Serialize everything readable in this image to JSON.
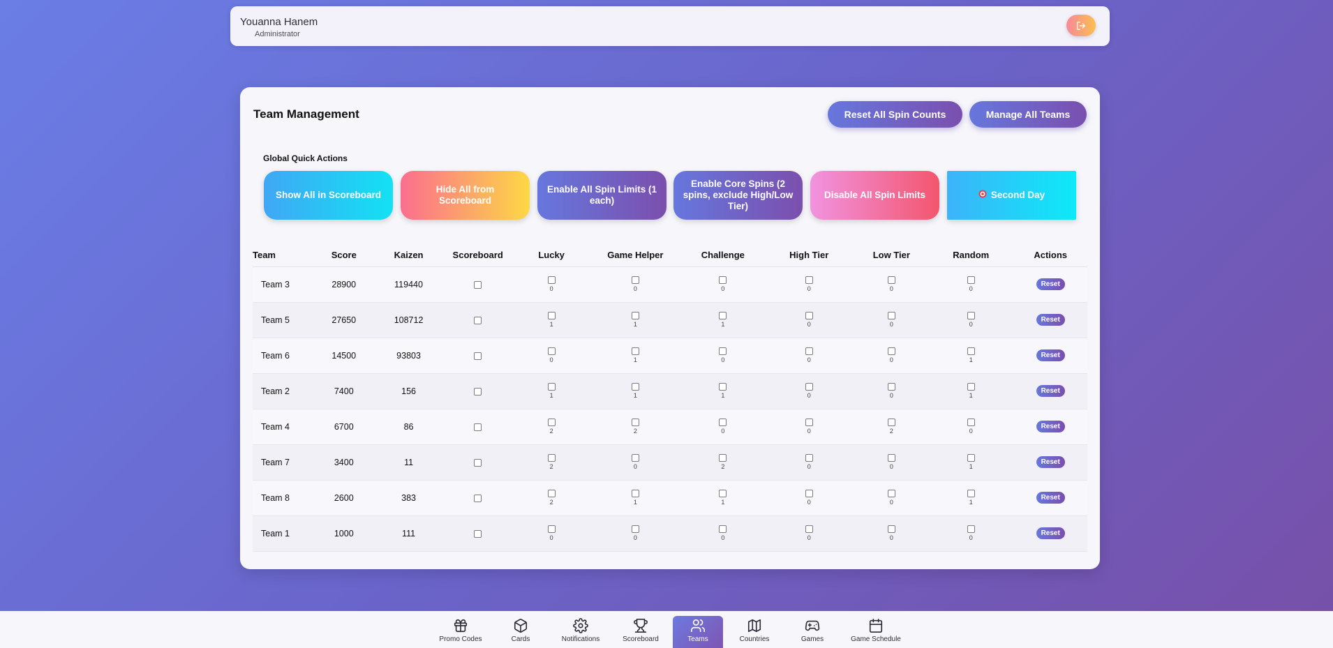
{
  "user": {
    "name": "Youanna Hanem",
    "role": "Administrator"
  },
  "page": {
    "title": "Team Management"
  },
  "header_buttons": {
    "reset_all": "Reset All Spin Counts",
    "manage_all": "Manage All Teams"
  },
  "quick_actions": {
    "label": "Global Quick Actions",
    "show_all": "Show All in Scoreboard",
    "hide_all": "Hide All from Scoreboard",
    "enable_all": "Enable All Spin Limits (1 each)",
    "enable_core": "Enable Core Spins (2 spins, exclude High/Low Tier)",
    "disable_all": "Disable All Spin Limits",
    "second_day": "Second Day"
  },
  "table": {
    "headers": [
      "Team",
      "Score",
      "Kaizen",
      "Scoreboard",
      "Lucky",
      "Game Helper",
      "Challenge",
      "High Tier",
      "Low Tier",
      "Random",
      "Actions"
    ],
    "reset_label": "Reset",
    "rows": [
      {
        "team": "Team 3",
        "score": "28900",
        "kaizen": "119440",
        "lucky": "0",
        "helper": "0",
        "challenge": "0",
        "high": "0",
        "low": "0",
        "random": "0"
      },
      {
        "team": "Team 5",
        "score": "27650",
        "kaizen": "108712",
        "lucky": "1",
        "helper": "1",
        "challenge": "1",
        "high": "0",
        "low": "0",
        "random": "0"
      },
      {
        "team": "Team 6",
        "score": "14500",
        "kaizen": "93803",
        "lucky": "0",
        "helper": "1",
        "challenge": "0",
        "high": "0",
        "low": "0",
        "random": "1"
      },
      {
        "team": "Team 2",
        "score": "7400",
        "kaizen": "156",
        "lucky": "1",
        "helper": "1",
        "challenge": "1",
        "high": "0",
        "low": "0",
        "random": "1"
      },
      {
        "team": "Team 4",
        "score": "6700",
        "kaizen": "86",
        "lucky": "2",
        "helper": "2",
        "challenge": "0",
        "high": "0",
        "low": "2",
        "random": "0"
      },
      {
        "team": "Team 7",
        "score": "3400",
        "kaizen": "11",
        "lucky": "2",
        "helper": "0",
        "challenge": "2",
        "high": "0",
        "low": "0",
        "random": "1"
      },
      {
        "team": "Team 8",
        "score": "2600",
        "kaizen": "383",
        "lucky": "2",
        "helper": "1",
        "challenge": "1",
        "high": "0",
        "low": "0",
        "random": "1"
      },
      {
        "team": "Team 1",
        "score": "1000",
        "kaizen": "111",
        "lucky": "0",
        "helper": "0",
        "challenge": "0",
        "high": "0",
        "low": "0",
        "random": "0"
      }
    ]
  },
  "nav": {
    "items": [
      {
        "label": "Promo Codes",
        "icon": "gift-icon"
      },
      {
        "label": "Cards",
        "icon": "box-icon"
      },
      {
        "label": "Notifications",
        "icon": "gear-icon"
      },
      {
        "label": "Scoreboard",
        "icon": "trophy-icon"
      },
      {
        "label": "Teams",
        "icon": "users-icon",
        "active": true
      },
      {
        "label": "Countries",
        "icon": "map-icon"
      },
      {
        "label": "Games",
        "icon": "gamepad-icon"
      },
      {
        "label": "Game Schedule",
        "icon": "calendar-icon"
      }
    ]
  },
  "colors": {
    "accent": "#6a64c9",
    "background": "#f6f6fb"
  }
}
